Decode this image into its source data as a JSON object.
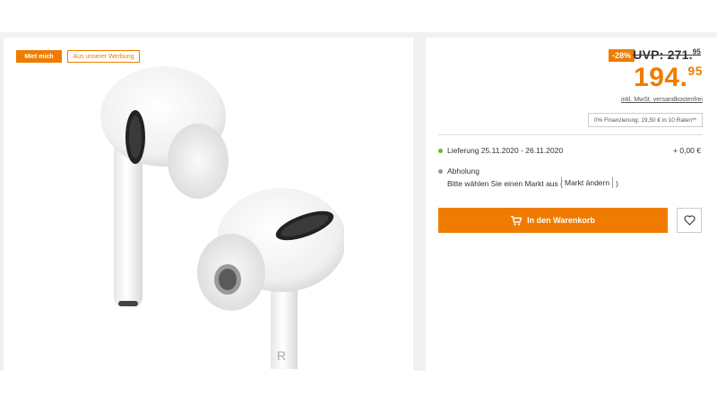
{
  "product": {
    "tags": {
      "miet": "Miet mich",
      "werbung": "Aus unserer Werbung"
    },
    "image_icon": "airpods-pro-image"
  },
  "pricing": {
    "discount": "-28%",
    "uvp_main": "UVP: 271.",
    "uvp_cents": "95",
    "price_main": "194.",
    "price_cents": "95",
    "vat_note": "inkl. MwSt. versandkostenfrei",
    "finance_note": "0% Finanzierung: 19,50 € in 10 Raten**"
  },
  "shipping": {
    "delivery_label": "Lieferung 25.11.2020 - 26.11.2020",
    "delivery_cost": "+ 0,00 €",
    "pickup_label": "Abholung",
    "pickup_text": "Bitte wählen Sie einen Markt aus (",
    "market_button": "Markt ändern",
    "pickup_text_end": ")"
  },
  "actions": {
    "cart_label": "In den Warenkorb",
    "cart_icon": "shopping-cart-icon",
    "wishlist_icon": "heart-icon"
  },
  "colors": {
    "accent": "#ef7c00",
    "available": "#6fb62c",
    "neutral_dot": "#999999"
  }
}
